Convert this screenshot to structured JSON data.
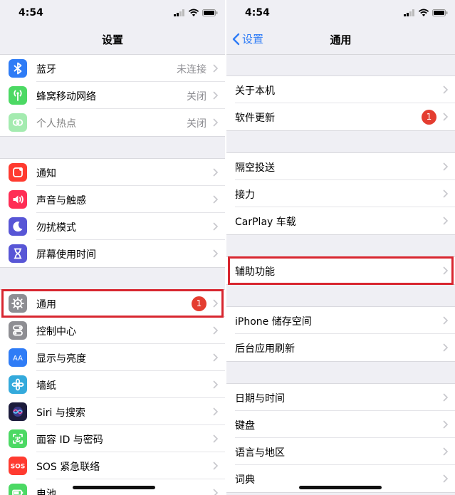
{
  "left": {
    "status_time": "4:54",
    "nav_title": "设置",
    "groups": [
      [
        {
          "label": "蓝牙",
          "value": "未连接",
          "icon": "bluetooth-icon",
          "color": "#2f7cf6"
        },
        {
          "label": "蜂窝移动网络",
          "value": "关闭",
          "icon": "cellular-antenna-icon",
          "color": "#4cd964"
        },
        {
          "label": "个人热点",
          "value": "关闭",
          "icon": "hotspot-link-icon",
          "color": "#4cd964",
          "dimmed": true
        }
      ],
      [
        {
          "label": "通知",
          "icon": "notifications-icon",
          "color": "#ff3b30"
        },
        {
          "label": "声音与触感",
          "icon": "speaker-icon",
          "color": "#ff2d55"
        },
        {
          "label": "勿扰模式",
          "icon": "moon-icon",
          "color": "#5856d6"
        },
        {
          "label": "屏幕使用时间",
          "icon": "hourglass-icon",
          "color": "#5856d6"
        }
      ],
      [
        {
          "label": "通用",
          "badge": "1",
          "icon": "gear-icon",
          "color": "#8e8e93",
          "highlighted": true
        },
        {
          "label": "控制中心",
          "icon": "toggles-icon",
          "color": "#8e8e93"
        },
        {
          "label": "显示与亮度",
          "icon": "text-size-icon",
          "color": "#2f7cf6"
        },
        {
          "label": "墙纸",
          "icon": "flower-icon",
          "color": "#34aadc"
        },
        {
          "label": "Siri 与搜索",
          "icon": "siri-icon",
          "color": "#1c1c3c"
        },
        {
          "label": "面容 ID 与密码",
          "icon": "face-id-icon",
          "color": "#4cd964"
        },
        {
          "label": "SOS 紧急联络",
          "icon": "sos-icon",
          "color": "#ff3b30"
        },
        {
          "label": "电池",
          "icon": "battery-icon",
          "color": "#4cd964"
        }
      ]
    ]
  },
  "right": {
    "status_time": "4:54",
    "nav_title": "通用",
    "back_label": "设置",
    "groups": [
      [
        {
          "label": "关于本机"
        },
        {
          "label": "软件更新",
          "badge": "1"
        }
      ],
      [
        {
          "label": "隔空投送"
        },
        {
          "label": "接力"
        },
        {
          "label": "CarPlay 车载"
        }
      ],
      [
        {
          "label": "辅助功能",
          "highlighted": true
        }
      ],
      [
        {
          "label": "iPhone 储存空间"
        },
        {
          "label": "后台应用刷新"
        }
      ],
      [
        {
          "label": "日期与时间"
        },
        {
          "label": "键盘"
        },
        {
          "label": "语言与地区"
        },
        {
          "label": "词典"
        }
      ]
    ]
  },
  "colors": {
    "highlight": "#d8262f",
    "badge": "#e43d30",
    "link": "#2f7cf6",
    "chevron": "#c7c7cc"
  }
}
